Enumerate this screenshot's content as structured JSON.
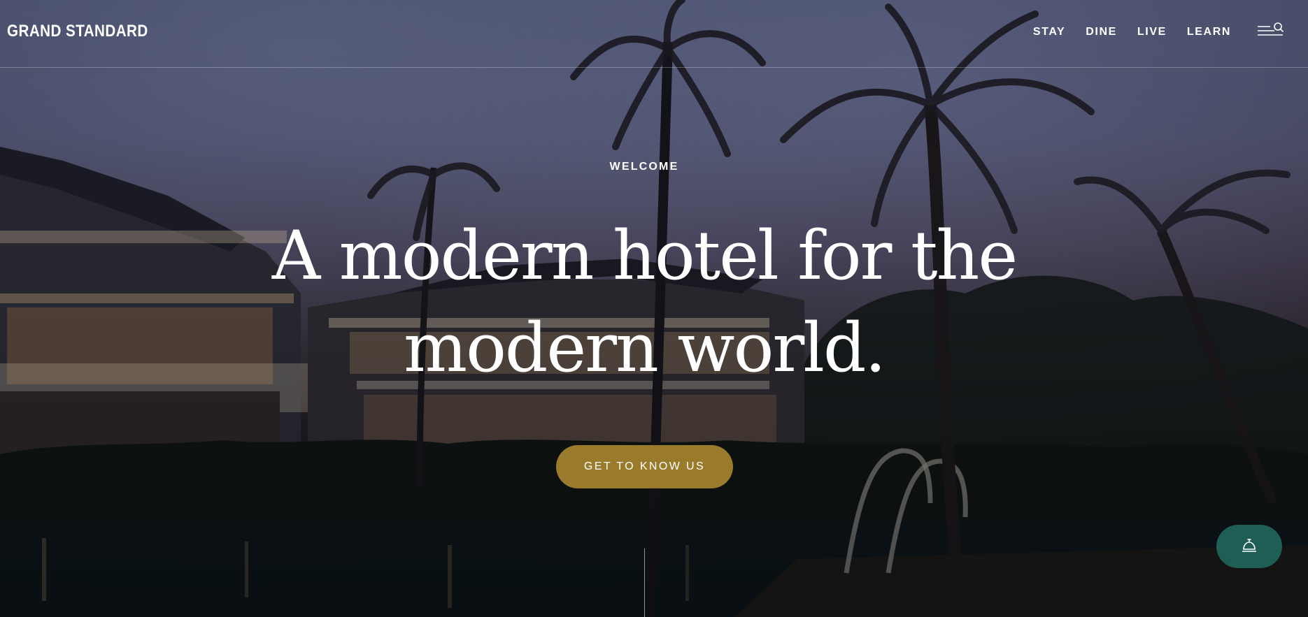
{
  "header": {
    "logo": "GRAND STANDARD",
    "nav": [
      {
        "label": "STAY"
      },
      {
        "label": "DINE"
      },
      {
        "label": "LIVE"
      },
      {
        "label": "LEARN"
      }
    ],
    "menu_icon": "menu-search-icon"
  },
  "hero": {
    "kicker": "WELCOME",
    "title_line1": "A modern hotel for the",
    "title_line2": "modern world.",
    "cta_label": "GET TO KNOW US"
  },
  "floating": {
    "concierge_icon": "service-bell-icon"
  },
  "colors": {
    "cta": "#9a7b2c",
    "concierge": "#1f5e55",
    "text": "#ffffff"
  }
}
